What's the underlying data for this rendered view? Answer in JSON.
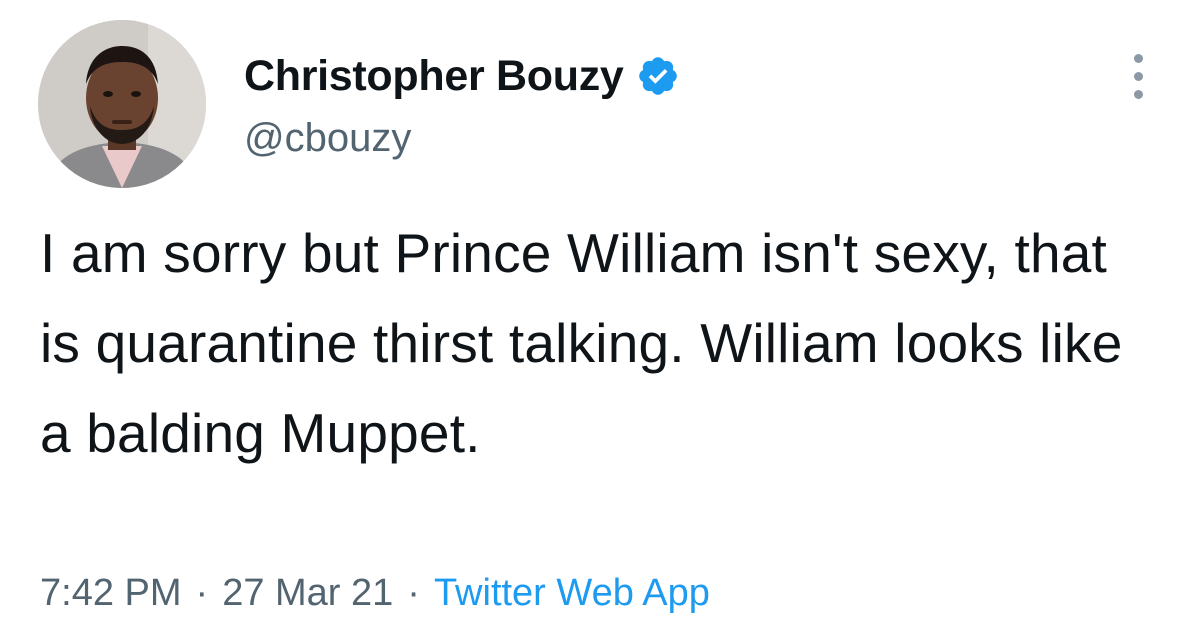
{
  "author": {
    "display_name": "Christopher Bouzy",
    "handle": "@cbouzy",
    "verified": true,
    "avatar_icon": "profile-photo"
  },
  "tweet": {
    "text": "I am sorry but Prince William isn't sexy, that is quarantine thirst talking. William looks like a balding Muppet."
  },
  "meta": {
    "time": "7:42 PM",
    "separator": "·",
    "date": "27 Mar 21",
    "source": "Twitter Web App"
  },
  "colors": {
    "text": "#0f1419",
    "secondary": "#536471",
    "accent": "#1d9bf0",
    "verified_badge": "#1d9bf0"
  }
}
